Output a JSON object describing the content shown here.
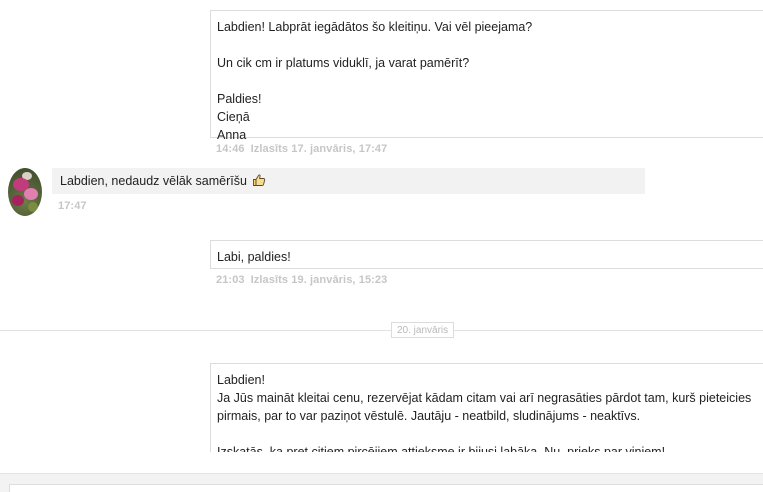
{
  "messages": [
    {
      "text": "Labdien! Labprāt iegādātos šo kleitiņu. Vai vēl pieejama?\n\nUn cik cm ir platums viduklī, ja varat pamērīt?\n\nPaldies!\nCieņā\nAnna",
      "time": "14:46",
      "read": "Izlasīts 17. janvāris, 17:47"
    },
    {
      "text": "Labdien, nedaudz vēlāk samērīšu",
      "emoji": "thumbs-up-icon",
      "time": "17:47"
    },
    {
      "text": "Labi, paldies!",
      "time": "21:03",
      "read": "Izlasīts 19. janvāris, 15:23"
    },
    {
      "text": "Labdien!\nJa Jūs maināt kleitai cenu, rezervējat kādam citam vai arī negrasāties pārdot tam, kurš pieteicies pirmais, par to var paziņot vēstulē. Jautāju - neatbild, sludinājums - neaktīvs.\n\nIzskatās, ka pret citiem pircējiem attieksme ir bijusi labāka. Nu, prieks par viņiem!"
    }
  ],
  "date_separator": "20. janvāris",
  "colors": {
    "meta_text": "#c6c6c6",
    "incoming_bubble": "#f2f2f2",
    "outgoing_border": "#dcdcdc"
  }
}
